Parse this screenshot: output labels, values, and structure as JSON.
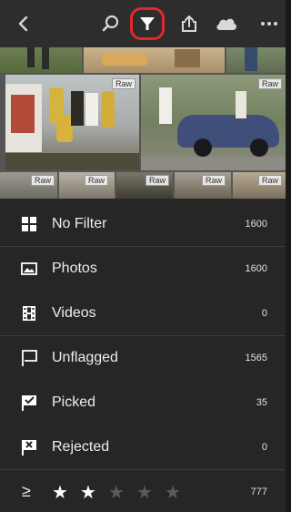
{
  "toolbar": {
    "icons": [
      "back-chevron-icon",
      "search-icon",
      "filter-funnel-icon",
      "share-icon",
      "cloud-icon",
      "more-icon"
    ],
    "active_color": "#e4262f"
  },
  "thumbnails": {
    "badge": "Raw"
  },
  "filters": [
    {
      "label": "No Filter",
      "count": "1600",
      "icon": "grid-icon"
    },
    {
      "label": "Photos",
      "count": "1600",
      "icon": "photo-icon"
    },
    {
      "label": "Videos",
      "count": "0",
      "icon": "film-icon"
    },
    {
      "label": "Unflagged",
      "count": "1565",
      "icon": "flag-icon"
    },
    {
      "label": "Picked",
      "count": "35",
      "icon": "picked-flag-icon"
    },
    {
      "label": "Rejected",
      "count": "0",
      "icon": "rejected-flag-icon"
    }
  ],
  "rating": {
    "operator": "≥",
    "stars": 2,
    "max_stars": 5,
    "count": "777"
  }
}
